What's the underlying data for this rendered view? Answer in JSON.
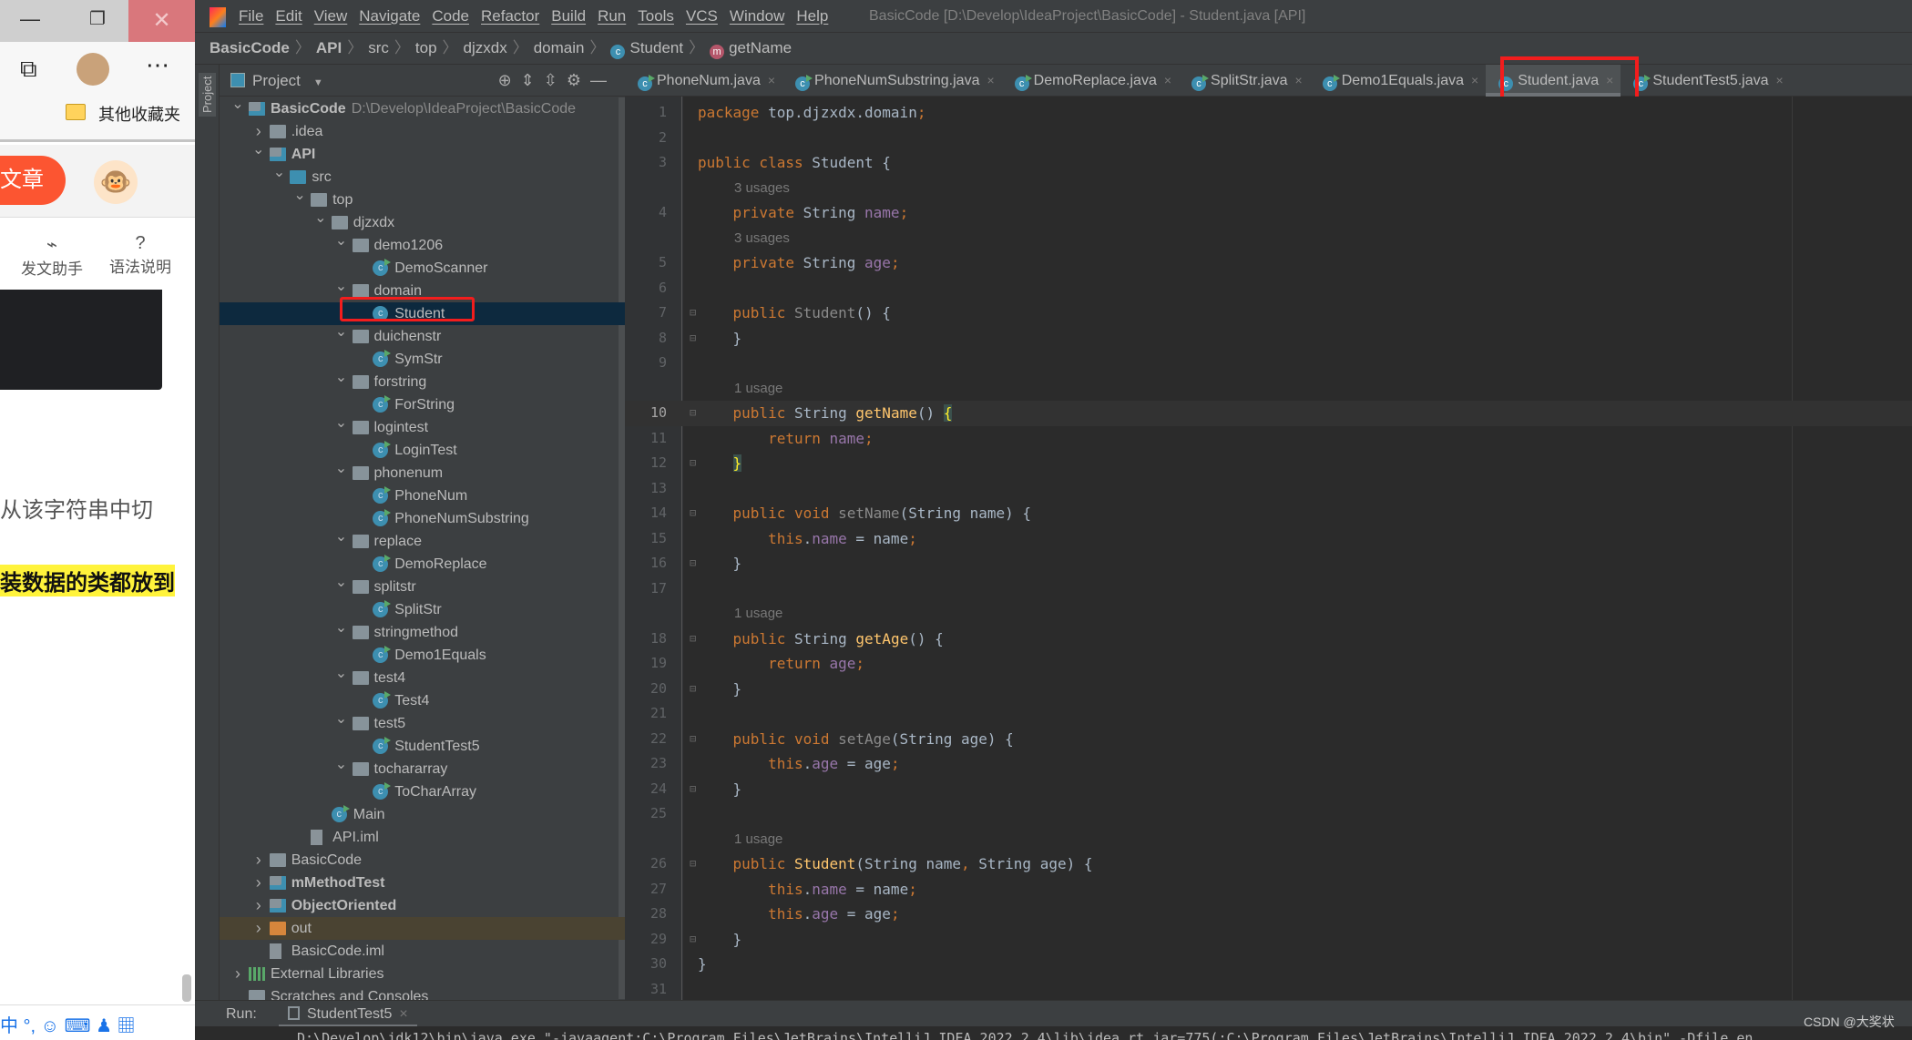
{
  "browser": {
    "favorites": "其他收藏夹",
    "article_button": "文章",
    "tools": [
      "发文助手",
      "语法说明"
    ],
    "text1": "从该字符串中切",
    "text2": "装数据的类都放到",
    "ime": "中 °, ☺ ⌨ ♟ ▦"
  },
  "ide": {
    "menu": [
      "File",
      "Edit",
      "View",
      "Navigate",
      "Code",
      "Refactor",
      "Build",
      "Run",
      "Tools",
      "VCS",
      "Window",
      "Help"
    ],
    "window_title": "BasicCode [D:\\Develop\\IdeaProject\\BasicCode] - Student.java [API]",
    "breadcrumbs": [
      "BasicCode",
      "API",
      "src",
      "top",
      "djzxdx",
      "domain",
      "Student",
      "getName"
    ],
    "project_panel": {
      "title": "Project",
      "side_label": "Project",
      "tree": [
        {
          "label": "BasicCode",
          "level": 0,
          "chev": "down",
          "icon": "module",
          "bold": true,
          "path": "D:\\Develop\\IdeaProject\\BasicCode"
        },
        {
          "label": ".idea",
          "level": 1,
          "chev": "right",
          "icon": "folder"
        },
        {
          "label": "API",
          "level": 1,
          "chev": "down",
          "icon": "module",
          "bold": true
        },
        {
          "label": "src",
          "level": 2,
          "chev": "down",
          "icon": "src"
        },
        {
          "label": "top",
          "level": 3,
          "chev": "down",
          "icon": "package"
        },
        {
          "label": "djzxdx",
          "level": 4,
          "chev": "down",
          "icon": "package"
        },
        {
          "label": "demo1206",
          "level": 5,
          "chev": "down",
          "icon": "package"
        },
        {
          "label": "DemoScanner",
          "level": 6,
          "icon": "class-run"
        },
        {
          "label": "domain",
          "level": 5,
          "chev": "down",
          "icon": "package"
        },
        {
          "label": "Student",
          "level": 6,
          "icon": "class",
          "selected": true
        },
        {
          "label": "duichenstr",
          "level": 5,
          "chev": "down",
          "icon": "package"
        },
        {
          "label": "SymStr",
          "level": 6,
          "icon": "class-run"
        },
        {
          "label": "forstring",
          "level": 5,
          "chev": "down",
          "icon": "package"
        },
        {
          "label": "ForString",
          "level": 6,
          "icon": "class-run"
        },
        {
          "label": "logintest",
          "level": 5,
          "chev": "down",
          "icon": "package"
        },
        {
          "label": "LoginTest",
          "level": 6,
          "icon": "class-run"
        },
        {
          "label": "phonenum",
          "level": 5,
          "chev": "down",
          "icon": "package"
        },
        {
          "label": "PhoneNum",
          "level": 6,
          "icon": "class-run"
        },
        {
          "label": "PhoneNumSubstring",
          "level": 6,
          "icon": "class-run"
        },
        {
          "label": "replace",
          "level": 5,
          "chev": "down",
          "icon": "package"
        },
        {
          "label": "DemoReplace",
          "level": 6,
          "icon": "class-run"
        },
        {
          "label": "splitstr",
          "level": 5,
          "chev": "down",
          "icon": "package"
        },
        {
          "label": "SplitStr",
          "level": 6,
          "icon": "class-run"
        },
        {
          "label": "stringmethod",
          "level": 5,
          "chev": "down",
          "icon": "package"
        },
        {
          "label": "Demo1Equals",
          "level": 6,
          "icon": "class-run"
        },
        {
          "label": "test4",
          "level": 5,
          "chev": "down",
          "icon": "package"
        },
        {
          "label": "Test4",
          "level": 6,
          "icon": "class-run"
        },
        {
          "label": "test5",
          "level": 5,
          "chev": "down",
          "icon": "package"
        },
        {
          "label": "StudentTest5",
          "level": 6,
          "icon": "class-run"
        },
        {
          "label": "tochararray",
          "level": 5,
          "chev": "down",
          "icon": "package"
        },
        {
          "label": "ToCharArray",
          "level": 6,
          "icon": "class-run"
        },
        {
          "label": "Main",
          "level": 4,
          "icon": "class-run"
        },
        {
          "label": "API.iml",
          "level": 3,
          "icon": "file"
        },
        {
          "label": "BasicCode",
          "level": 1,
          "chev": "right",
          "icon": "folder"
        },
        {
          "label": "mMethodTest",
          "level": 1,
          "chev": "right",
          "icon": "module",
          "bold": true
        },
        {
          "label": "ObjectOriented",
          "level": 1,
          "chev": "right",
          "icon": "module",
          "bold": true
        },
        {
          "label": "out",
          "level": 1,
          "chev": "right",
          "icon": "folder-orange",
          "highlight": true
        },
        {
          "label": "BasicCode.iml",
          "level": 1,
          "icon": "file"
        },
        {
          "label": "External Libraries",
          "level": 0,
          "chev": "right",
          "icon": "library"
        },
        {
          "label": "Scratches and Consoles",
          "level": 0,
          "icon": "scratch"
        }
      ]
    },
    "tabs": [
      {
        "label": "PhoneNum.java"
      },
      {
        "label": "PhoneNumSubstring.java"
      },
      {
        "label": "DemoReplace.java"
      },
      {
        "label": "SplitStr.java"
      },
      {
        "label": "Demo1Equals.java"
      },
      {
        "label": "Student.java",
        "active": true
      },
      {
        "label": "StudentTest5.java"
      }
    ],
    "code": [
      {
        "n": "1",
        "t": [
          [
            "kw",
            "package "
          ],
          [
            "",
            "top.djzxdx.domain"
          ],
          [
            "kw",
            ";"
          ]
        ]
      },
      {
        "n": "2",
        "t": []
      },
      {
        "n": "3",
        "t": [
          [
            "kw",
            "public class "
          ],
          [
            "",
            "Student {"
          ]
        ]
      },
      {
        "hint": "3 usages"
      },
      {
        "n": "4",
        "t": [
          [
            "kw",
            "    private "
          ],
          [
            "",
            "String "
          ],
          [
            "fd",
            "name"
          ],
          [
            "kw",
            ";"
          ]
        ]
      },
      {
        "hint": "3 usages"
      },
      {
        "n": "5",
        "t": [
          [
            "kw",
            "    private "
          ],
          [
            "",
            "String "
          ],
          [
            "fd",
            "age"
          ],
          [
            "kw",
            ";"
          ]
        ]
      },
      {
        "n": "6",
        "t": []
      },
      {
        "n": "7",
        "fold": "open",
        "t": [
          [
            "kw",
            "    public "
          ],
          [
            "gr",
            "Student"
          ],
          [
            "",
            "() {"
          ]
        ]
      },
      {
        "n": "8",
        "fold": "close",
        "t": [
          [
            "",
            "    }"
          ]
        ]
      },
      {
        "n": "9",
        "t": []
      },
      {
        "hint": "1 usage"
      },
      {
        "n": "10",
        "fold": "open",
        "current": true,
        "t": [
          [
            "kw",
            "    public "
          ],
          [
            "",
            "String "
          ],
          [
            "me",
            "getName"
          ],
          [
            "",
            "() "
          ],
          [
            "br",
            "{"
          ]
        ]
      },
      {
        "n": "11",
        "t": [
          [
            "kw",
            "        return "
          ],
          [
            "fd",
            "name"
          ],
          [
            "kw",
            ";"
          ]
        ]
      },
      {
        "n": "12",
        "fold": "close",
        "t": [
          [
            "",
            "    "
          ],
          [
            "br",
            "}"
          ]
        ]
      },
      {
        "n": "13",
        "t": []
      },
      {
        "n": "14",
        "fold": "open",
        "t": [
          [
            "kw",
            "    public void "
          ],
          [
            "gr",
            "setName"
          ],
          [
            "",
            "(String name) {"
          ]
        ]
      },
      {
        "n": "15",
        "t": [
          [
            "kw",
            "        this"
          ],
          [
            "",
            "."
          ],
          [
            "fd",
            "name"
          ],
          [
            "",
            " = name"
          ],
          [
            "kw",
            ";"
          ]
        ]
      },
      {
        "n": "16",
        "fold": "close",
        "t": [
          [
            "",
            "    }"
          ]
        ]
      },
      {
        "n": "17",
        "t": []
      },
      {
        "hint": "1 usage"
      },
      {
        "n": "18",
        "fold": "open",
        "t": [
          [
            "kw",
            "    public "
          ],
          [
            "",
            "String "
          ],
          [
            "me",
            "getAge"
          ],
          [
            "",
            "() {"
          ]
        ]
      },
      {
        "n": "19",
        "t": [
          [
            "kw",
            "        return "
          ],
          [
            "fd",
            "age"
          ],
          [
            "kw",
            ";"
          ]
        ]
      },
      {
        "n": "20",
        "fold": "close",
        "t": [
          [
            "",
            "    }"
          ]
        ]
      },
      {
        "n": "21",
        "t": []
      },
      {
        "n": "22",
        "fold": "open",
        "t": [
          [
            "kw",
            "    public void "
          ],
          [
            "gr",
            "setAge"
          ],
          [
            "",
            "(String age) {"
          ]
        ]
      },
      {
        "n": "23",
        "t": [
          [
            "kw",
            "        this"
          ],
          [
            "",
            "."
          ],
          [
            "fd",
            "age"
          ],
          [
            "",
            " = age"
          ],
          [
            "kw",
            ";"
          ]
        ]
      },
      {
        "n": "24",
        "fold": "close",
        "t": [
          [
            "",
            "    }"
          ]
        ]
      },
      {
        "n": "25",
        "t": []
      },
      {
        "hint": "1 usage"
      },
      {
        "n": "26",
        "fold": "open",
        "t": [
          [
            "kw",
            "    public "
          ],
          [
            "me",
            "Student"
          ],
          [
            "",
            "(String name"
          ],
          [
            "kw",
            ", "
          ],
          [
            "",
            "String age) {"
          ]
        ]
      },
      {
        "n": "27",
        "t": [
          [
            "kw",
            "        this"
          ],
          [
            "",
            "."
          ],
          [
            "fd",
            "name"
          ],
          [
            "",
            " = name"
          ],
          [
            "kw",
            ";"
          ]
        ]
      },
      {
        "n": "28",
        "t": [
          [
            "kw",
            "        this"
          ],
          [
            "",
            "."
          ],
          [
            "fd",
            "age"
          ],
          [
            "",
            " = age"
          ],
          [
            "kw",
            ";"
          ]
        ]
      },
      {
        "n": "29",
        "fold": "close",
        "t": [
          [
            "",
            "    }"
          ]
        ]
      },
      {
        "n": "30",
        "t": [
          [
            "",
            "}"
          ]
        ]
      },
      {
        "n": "31",
        "t": []
      }
    ],
    "run": {
      "label": "Run:",
      "tab": "StudentTest5",
      "console": "D:\\Develop\\jdk12\\bin\\java.exe \"-javaagent:C:\\Program Files\\JetBrains\\IntelliJ IDEA 2022.2.4\\lib\\idea_rt.jar=775(:C:\\Program Files\\JetBrains\\IntelliJ IDEA 2022.2.4\\bin\" -Dfile.en"
    },
    "watermark": "CSDN @大奖状"
  },
  "colors": {
    "keyword": "#cc7832",
    "field": "#9876aa",
    "method": "#ffc66d",
    "text": "#a9b7c6",
    "highlight_box": "#f21d1d"
  }
}
